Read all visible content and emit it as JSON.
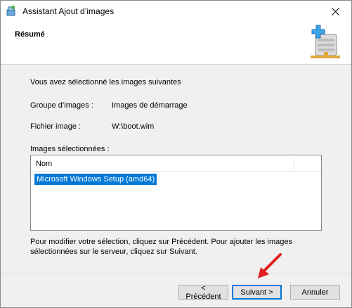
{
  "window": {
    "title": "Assistant Ajout d’images",
    "title_icon": "server-wizard-icon",
    "close_icon": "close-icon"
  },
  "header": {
    "title": "Résumé",
    "icon": "image-add-server-icon"
  },
  "intro": "Vous avez sélectionné les images suivantes",
  "details": {
    "group_label": "Groupe d’images :",
    "group_value": "Images de démarrage",
    "file_label": "Fichier image :",
    "file_value": "W:\\boot.wim"
  },
  "selected_label": "Images sélectionnées :",
  "list": {
    "column": "Nom",
    "rows": [
      "Microsoft Windows Setup (amd64)"
    ],
    "selected_color": "#0078d7"
  },
  "hint": "Pour modifier votre sélection, cliquez sur Précédent. Pour ajouter les images sélectionnées sur le serveur, cliquez sur Suivant.",
  "buttons": {
    "back": "< Précédent",
    "next": "Suivant >",
    "cancel": "Annuler"
  },
  "annotation": {
    "icon": "red-arrow-icon",
    "color": "#e02020"
  }
}
